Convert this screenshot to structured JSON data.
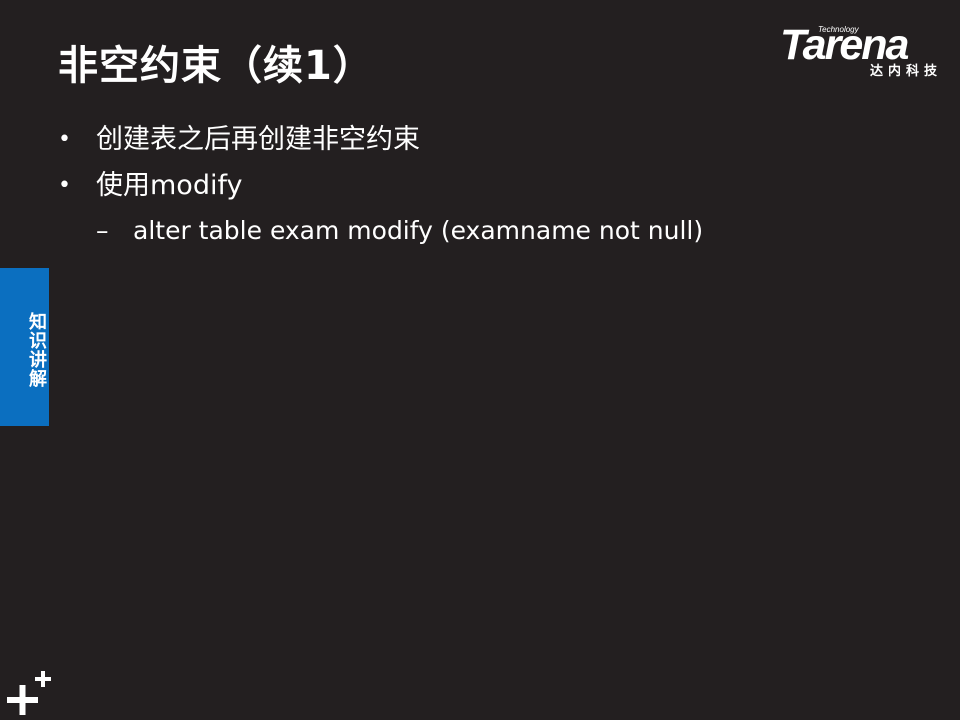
{
  "slide": {
    "title": "非空约束（续1）",
    "bullets": [
      {
        "mark": "•",
        "text": "创建表之后再创建非空约束"
      },
      {
        "mark": "•",
        "text": "使用modify"
      }
    ],
    "sub_bullets": [
      {
        "mark": "–",
        "text": "alter table exam modify (examname not null)"
      }
    ]
  },
  "logo": {
    "technology": "Technology",
    "word": "Tarena",
    "chinese": "达内科技"
  },
  "sidetab": {
    "label": "知识讲解"
  },
  "colors": {
    "background": "#231f20",
    "sidetab": "#0b6fc0",
    "text": "#ffffff"
  },
  "icons": {
    "corner": "plus-icon"
  }
}
